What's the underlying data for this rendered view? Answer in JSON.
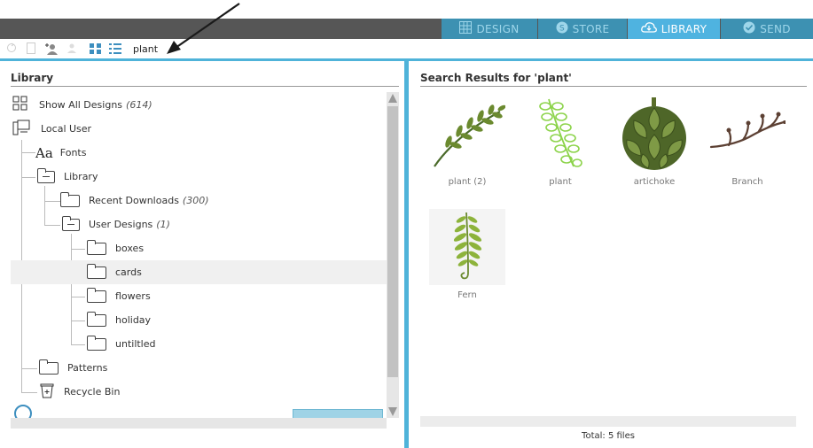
{
  "nav": {
    "tabs": [
      {
        "label": "DESIGN",
        "icon": "grid-icon"
      },
      {
        "label": "STORE",
        "icon": "store-s-icon"
      },
      {
        "label": "LIBRARY",
        "icon": "cloud-icon"
      },
      {
        "label": "SEND",
        "icon": "check-circle-icon"
      }
    ],
    "active": "LIBRARY"
  },
  "toolbar": {
    "search_value": "plant"
  },
  "library": {
    "title": "Library",
    "tree": [
      {
        "label": "Show All Designs",
        "count": "(614)"
      },
      {
        "label": "Local User"
      },
      {
        "label": "Fonts"
      },
      {
        "label": "Library"
      },
      {
        "label": "Recent Downloads",
        "count": "(300)"
      },
      {
        "label": "User Designs",
        "count": "(1)"
      },
      {
        "label": "boxes"
      },
      {
        "label": "cards"
      },
      {
        "label": "flowers"
      },
      {
        "label": "holiday"
      },
      {
        "label": "untiltled"
      },
      {
        "label": "Patterns"
      },
      {
        "label": "Recycle Bin"
      }
    ]
  },
  "results": {
    "title": "Search Results for 'plant'",
    "items": [
      {
        "name": "plant (2)"
      },
      {
        "name": "plant"
      },
      {
        "name": "artichoke"
      },
      {
        "name": "Branch"
      },
      {
        "name": "Fern"
      }
    ],
    "total": "Total: 5 files"
  },
  "colors": {
    "accent": "#4fb3d9",
    "nav_dark": "#565656",
    "nav_tab": "#3d91b2",
    "nav_active": "#4fb3e0"
  }
}
